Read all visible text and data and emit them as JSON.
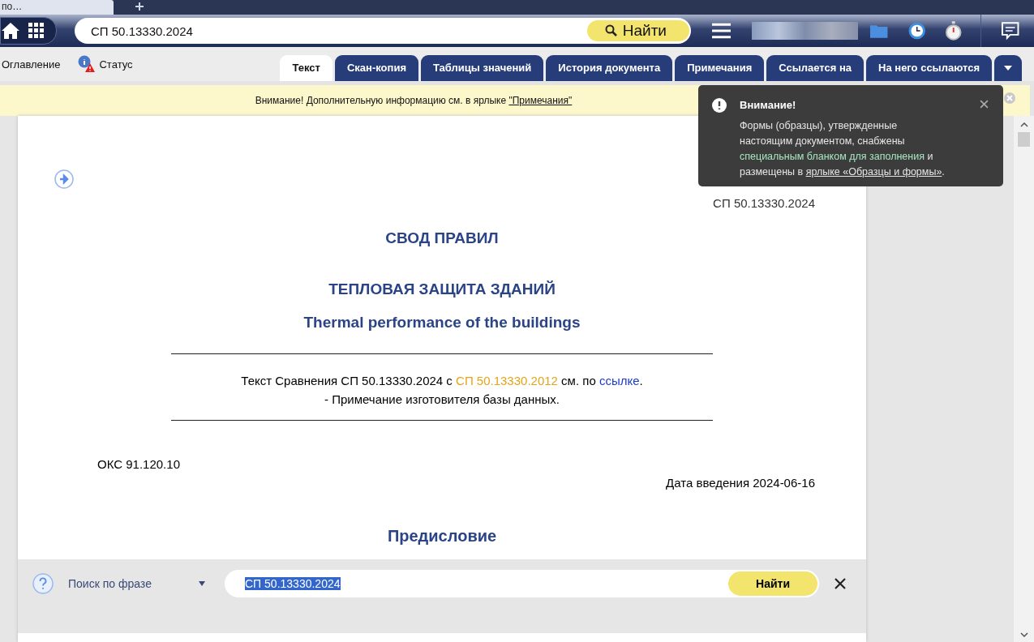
{
  "browser_tab": {
    "title": "по…"
  },
  "toolbar": {
    "search_value": "СП 50.13330.2024",
    "search_button": "Найти"
  },
  "doc_links": [
    {
      "label": "Оглавление",
      "kind": "plain"
    },
    {
      "label": "Статус",
      "kind": "status"
    }
  ],
  "tabs": [
    {
      "label": "Текст",
      "selected": true
    },
    {
      "label": "Скан-копия",
      "selected": false
    },
    {
      "label": "Таблицы значений",
      "selected": false
    },
    {
      "label": "История документа",
      "selected": false
    },
    {
      "label": "Примечания",
      "selected": false
    },
    {
      "label": "Ссылается на",
      "selected": false
    },
    {
      "label": "На него ссылаются",
      "selected": false
    }
  ],
  "notice": {
    "text": "Внимание! Дополнительную информацию см. в ярлыке",
    "link": "\"Примечания\""
  },
  "document": {
    "code": "СП 50.13330.2024",
    "heading": "СВОД ПРАВИЛ",
    "title": "ТЕПЛОВАЯ ЗАЩИТА ЗДАНИЙ",
    "title_en": "Thermal performance of the buildings",
    "comparison": [
      {
        "text": "Текст Сравнения СП 50.13330.2024 с ",
        "kind": "plain"
      },
      {
        "text": "СП 50.13330.2012",
        "kind": "doc-link"
      },
      {
        "text": " см. по ",
        "kind": "plain"
      },
      {
        "text": "ссылке",
        "kind": "link"
      },
      {
        "text": ".",
        "kind": "plain"
      }
    ],
    "comparison_note": "- Примечание изготовителя базы данных.",
    "oks": "ОКС 91.120.10",
    "date": "Дата введения 2024-06-16",
    "section": "Предисловие"
  },
  "popup": {
    "title": "Внимание!",
    "body": [
      {
        "text": "Формы (образцы), утвержденные настоящим документом, снабжены ",
        "kind": "plain"
      },
      {
        "text": "специальным бланком для заполнения",
        "kind": "accent"
      },
      {
        "text": " и размещены в ",
        "kind": "plain"
      },
      {
        "text": "ярлыке «Образцы и формы»",
        "kind": "link"
      },
      {
        "text": ".",
        "kind": "plain"
      }
    ]
  },
  "find_bar": {
    "mode": "Поиск по фразе",
    "value": "СП 50.13330.2024",
    "button": "Найти"
  }
}
